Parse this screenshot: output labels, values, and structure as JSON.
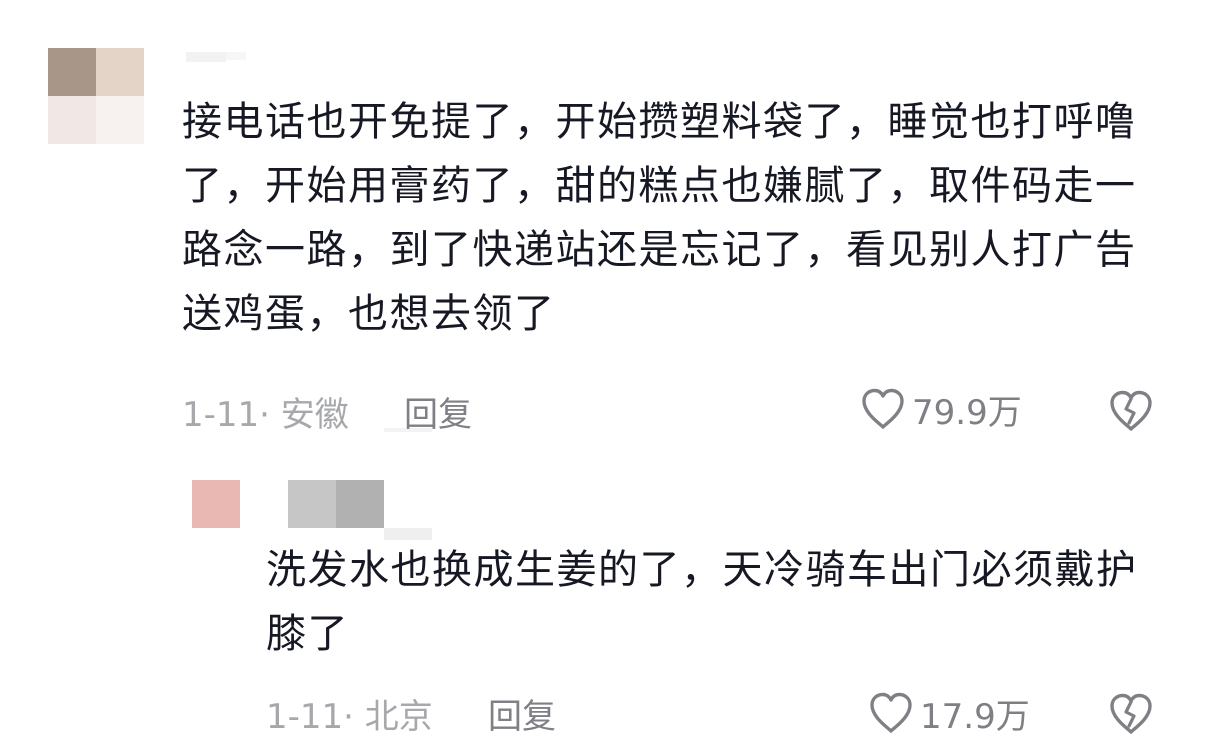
{
  "main_comment": {
    "text": "接电话也开免提了，开始攒塑料袋了，睡觉也打呼噜了，开始用膏药了，甜的糕点也嫌腻了，取件码走一路念一路，到了快递站还是忘记了，看见别人打广告送鸡蛋，也想去领了",
    "meta": "1-11· 安徽",
    "reply_label": "回复",
    "likes": "79.9万",
    "avatar_colors": [
      "#a89688",
      "#e3d4c7",
      "#f1e8e6",
      "#f7f2ef"
    ]
  },
  "reply_comment": {
    "text": "洗发水也换成生姜的了，天冷骑车出门必须戴护膝了",
    "meta": "1-11· 北京",
    "reply_label": "回复",
    "likes": "17.9万",
    "avatar_colors": [
      "#eab8b2"
    ]
  },
  "icons": {
    "like": "heart-outline-icon",
    "dislike": "broken-heart-icon"
  },
  "colors": {
    "text": "#161823",
    "meta": "#a7a8ab",
    "action": "#7f8085"
  }
}
